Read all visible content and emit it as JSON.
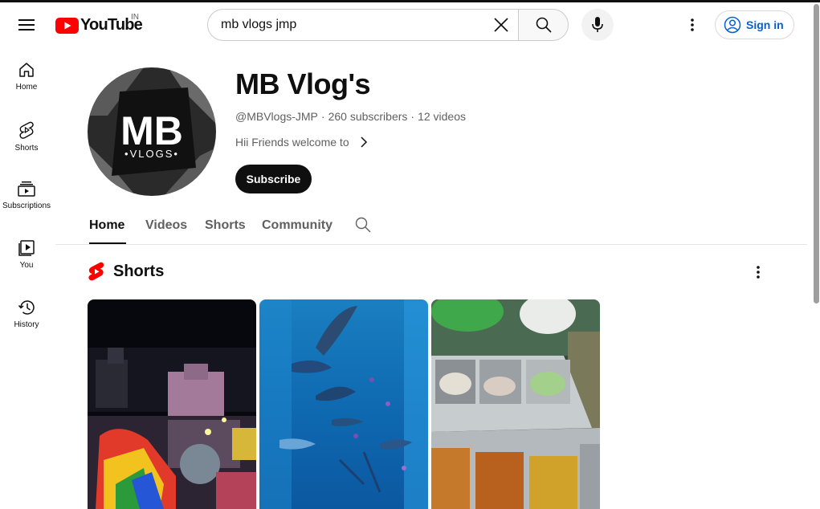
{
  "header": {
    "logo_text": "YouTube",
    "region": "IN",
    "search_value": "mb vlogs jmp",
    "signin_label": "Sign in"
  },
  "sidebar": {
    "items": [
      {
        "label": "Home",
        "icon": "home-icon"
      },
      {
        "label": "Shorts",
        "icon": "shorts-icon"
      },
      {
        "label": "Subscriptions",
        "icon": "subscriptions-icon"
      },
      {
        "label": "You",
        "icon": "you-icon"
      },
      {
        "label": "History",
        "icon": "history-icon"
      }
    ]
  },
  "channel": {
    "name": "MB Vlog's",
    "handle": "@MBVlogs-JMP",
    "subscribers": "260 subscribers",
    "videos": "12 videos",
    "description": "Hii Friends welcome to",
    "subscribe_label": "Subscribe",
    "avatar_text_main": "MB",
    "avatar_text_sub": "•VLOGS•"
  },
  "tabs": [
    {
      "label": "Home",
      "active": true
    },
    {
      "label": "Videos",
      "active": false
    },
    {
      "label": "Shorts",
      "active": false
    },
    {
      "label": "Community",
      "active": false
    }
  ],
  "section": {
    "title": "Shorts"
  },
  "colors": {
    "brand_red": "#ff0000",
    "link_blue": "#065fd4",
    "text": "#0f0f0f",
    "secondary": "#606060"
  }
}
